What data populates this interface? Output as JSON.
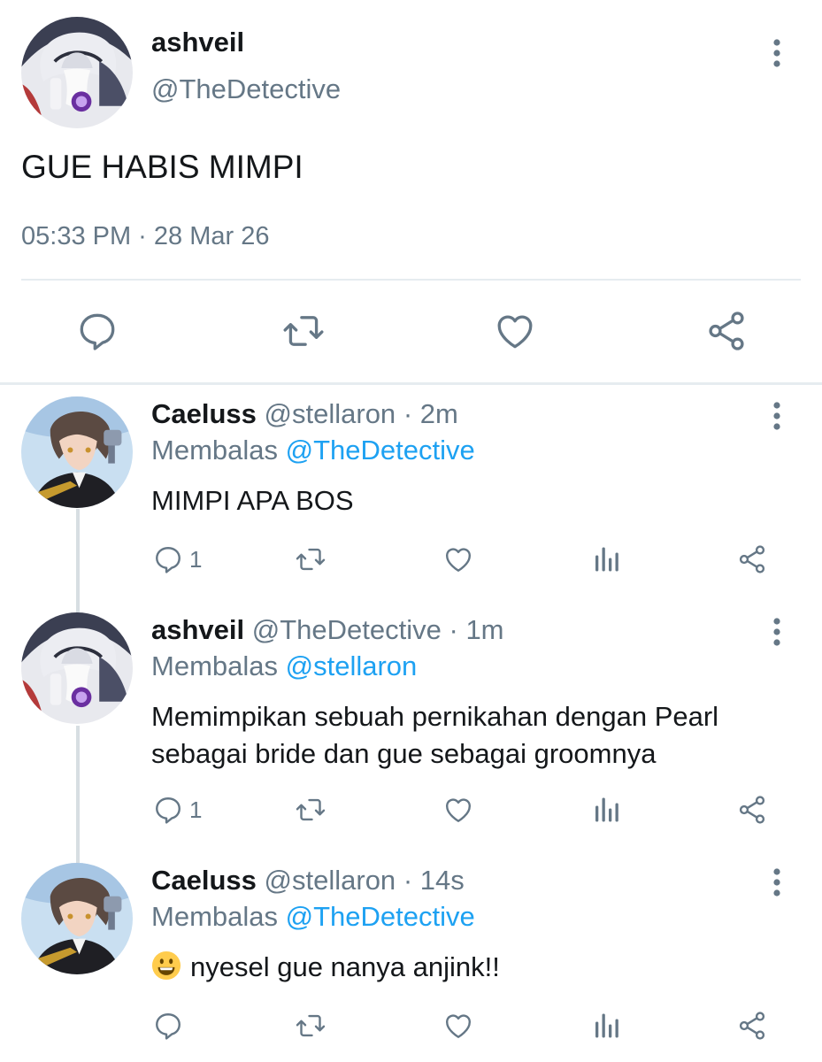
{
  "main_tweet": {
    "name": "ashveil",
    "handle": "@TheDetective",
    "text": "GUE HABIS MIMPI",
    "timestamp": "05:33 PM · 28 Mar 26",
    "avatar": "avatar-ashveil",
    "icons": [
      "reply-icon",
      "retweet-icon",
      "like-icon",
      "share-icon",
      "more-vertical-icon"
    ]
  },
  "replies": [
    {
      "name": "Caeluss",
      "handle": "@stellaron",
      "dot": "·",
      "time": "2m",
      "reply_prefix": "Membalas",
      "reply_to": "@TheDetective",
      "text": "MIMPI APA BOS",
      "reply_count": "1",
      "avatar": "avatar-caeluss"
    },
    {
      "name": "ashveil",
      "handle": "@TheDetective",
      "dot": "·",
      "time": "1m",
      "reply_prefix": "Membalas",
      "reply_to": "@stellaron",
      "text": "Memimpikan sebuah pernikahan dengan Pearl sebagai bride dan gue sebagai groomnya",
      "reply_count": "1",
      "avatar": "avatar-ashveil"
    },
    {
      "name": "Caeluss",
      "handle": "@stellaron",
      "dot": "·",
      "time": "14s",
      "reply_prefix": "Membalas",
      "reply_to": "@TheDetective",
      "emoji": "grinning-face",
      "text": "nyesel gue nanya anjink!!",
      "reply_count": "",
      "avatar": "avatar-caeluss"
    }
  ],
  "colors": {
    "text": "#14171a",
    "secondary": "#657786",
    "mention": "#1da1f2",
    "divider": "#e6ecf0",
    "thread_line": "#d7dee2"
  }
}
